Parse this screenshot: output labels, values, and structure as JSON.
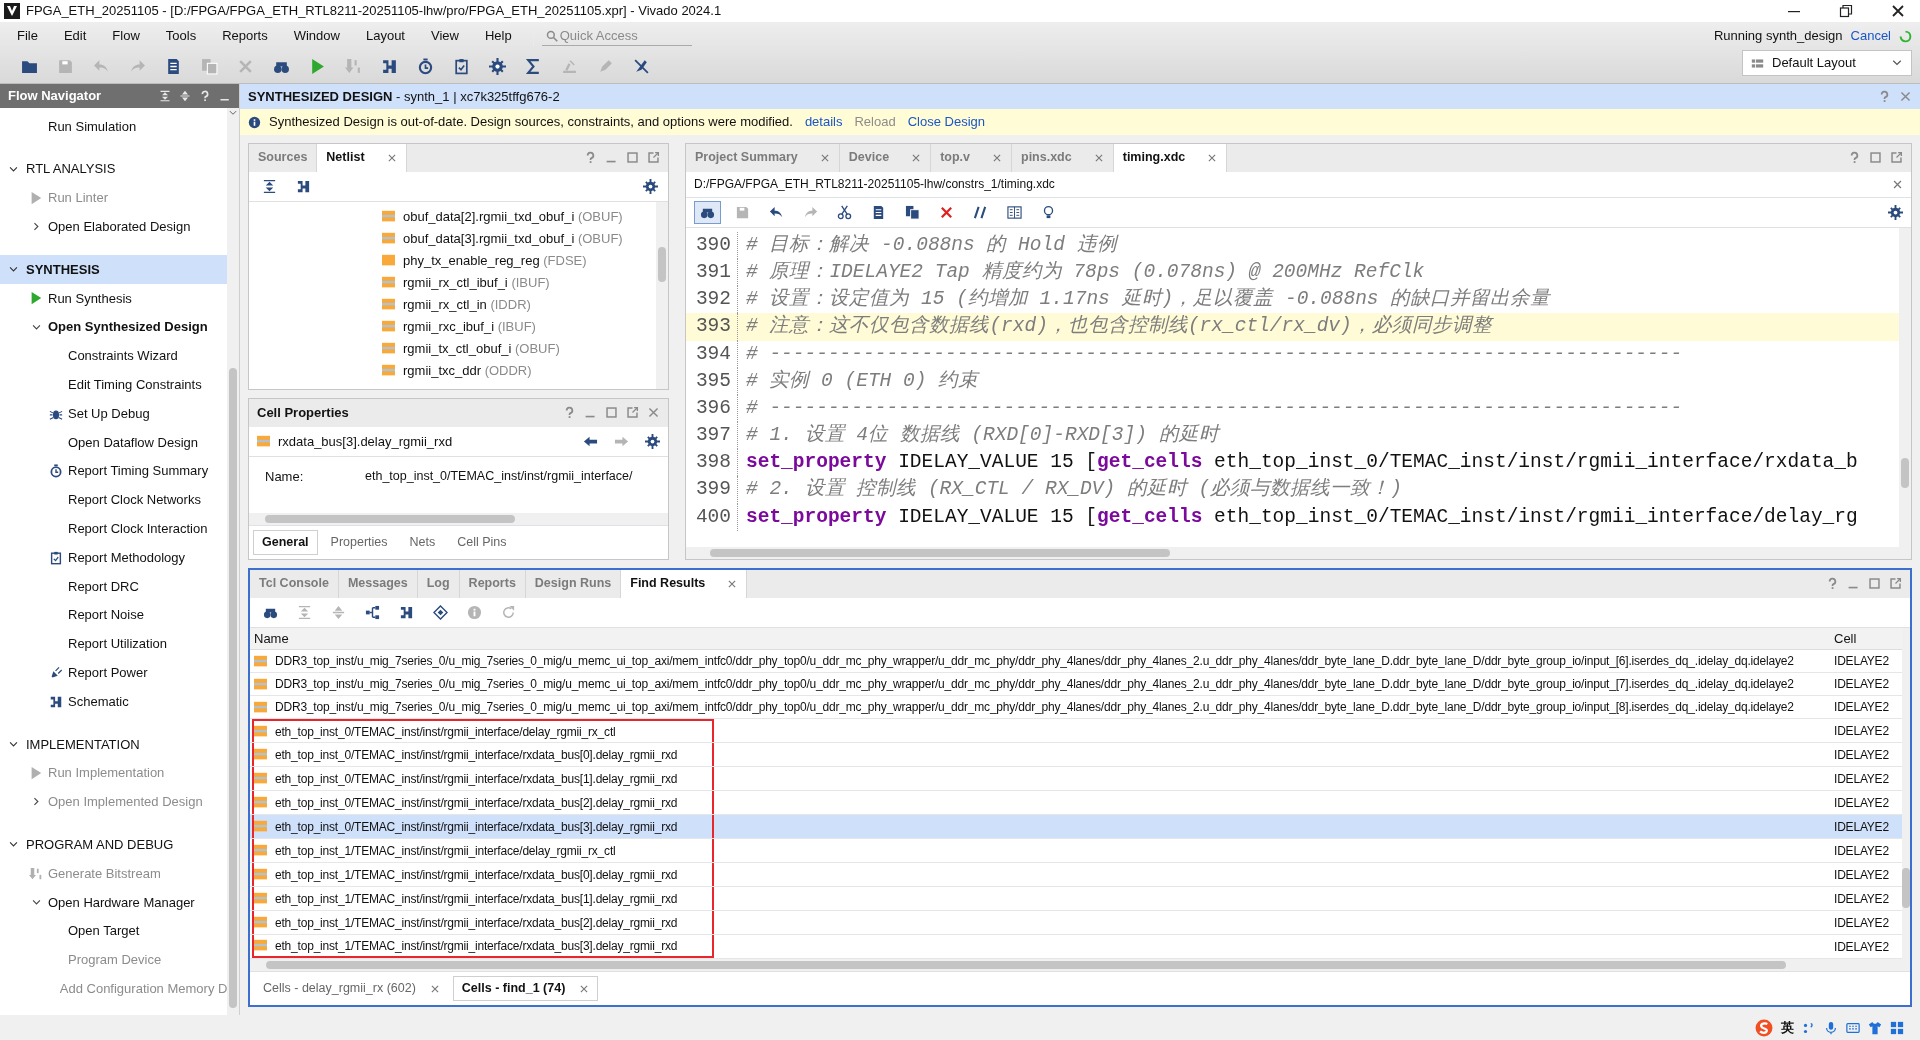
{
  "title_bar": {
    "title": "FPGA_ETH_20251105 - [D:/FPGA/FPGA_ETH_RTL8211-20251105-lhw/pro/FPGA_ETH_20251105.xpr] - Vivado 2024.1"
  },
  "menu": [
    "File",
    "Edit",
    "Flow",
    "Tools",
    "Reports",
    "Window",
    "Layout",
    "View",
    "Help"
  ],
  "quick_access": {
    "placeholder": "Quick Access"
  },
  "toolbar": [
    {
      "kind": "open",
      "disabled": false
    },
    {
      "kind": "save",
      "disabled": true
    },
    {
      "kind": "undo",
      "disabled": true
    },
    {
      "kind": "redo",
      "disabled": true
    },
    {
      "kind": "copy",
      "disabled": false
    },
    {
      "kind": "paste",
      "disabled": true
    },
    {
      "kind": "delete",
      "disabled": true
    },
    {
      "kind": "find",
      "disabled": false
    },
    {
      "kind": "run",
      "disabled": false
    },
    {
      "kind": "bitstream",
      "disabled": true
    },
    {
      "kind": "schematic",
      "disabled": false
    },
    {
      "kind": "timer",
      "disabled": false
    },
    {
      "kind": "checklist",
      "disabled": false
    },
    {
      "kind": "settings",
      "disabled": false
    },
    {
      "kind": "sum",
      "disabled": false
    },
    {
      "kind": "stamp",
      "disabled": true
    },
    {
      "kind": "pen",
      "disabled": true
    },
    {
      "kind": "nodebug",
      "disabled": false
    }
  ],
  "status": {
    "text": "Running synth_design",
    "link": "Cancel"
  },
  "layout_select": {
    "value": "Default Layout"
  },
  "flow_navigator": {
    "title": "Flow Navigator",
    "sections": [
      {
        "items": [
          {
            "label": "Run Simulation",
            "kind": "plain",
            "disabled": false,
            "active": false
          }
        ]
      },
      {
        "label": "RTL ANALYSIS",
        "expanded": true,
        "selected": false,
        "items": [
          {
            "label": "Run Linter",
            "kind": "run",
            "disabled": true,
            "active": false
          },
          {
            "label": "Open Elaborated Design",
            "kind": "group",
            "expanded": false,
            "disabled": false,
            "active": false
          }
        ]
      },
      {
        "label": "SYNTHESIS",
        "expanded": true,
        "selected": true,
        "items": [
          {
            "label": "Run Synthesis",
            "kind": "run",
            "disabled": false,
            "active": false
          },
          {
            "label": "Open Synthesized Design",
            "kind": "group",
            "expanded": true,
            "disabled": false,
            "active": true,
            "children": [
              {
                "label": "Constraints Wizard",
                "kind": "plain",
                "disabled": false,
                "active": false
              },
              {
                "label": "Edit Timing Constraints",
                "kind": "plain",
                "disabled": false,
                "active": false
              },
              {
                "label": "Set Up Debug",
                "kind": "debug",
                "disabled": false,
                "active": false
              },
              {
                "label": "Open Dataflow Design",
                "kind": "plain",
                "disabled": false,
                "active": false
              },
              {
                "label": "Report Timing Summary",
                "kind": "timer",
                "disabled": false,
                "active": false
              },
              {
                "label": "Report Clock Networks",
                "kind": "plain",
                "disabled": false,
                "active": false
              },
              {
                "label": "Report Clock Interaction",
                "kind": "plain",
                "disabled": false,
                "active": false
              },
              {
                "label": "Report Methodology",
                "kind": "checklist",
                "disabled": false,
                "active": false
              },
              {
                "label": "Report DRC",
                "kind": "plain",
                "disabled": false,
                "active": false
              },
              {
                "label": "Report Noise",
                "kind": "plain",
                "disabled": false,
                "active": false
              },
              {
                "label": "Report Utilization",
                "kind": "plain",
                "disabled": false,
                "active": false
              },
              {
                "label": "Report Power",
                "kind": "power",
                "disabled": false,
                "active": false
              },
              {
                "label": "Schematic",
                "kind": "schematic",
                "disabled": false,
                "active": false
              }
            ]
          }
        ]
      },
      {
        "label": "IMPLEMENTATION",
        "expanded": true,
        "selected": false,
        "items": [
          {
            "label": "Run Implementation",
            "kind": "run",
            "disabled": true,
            "active": false
          },
          {
            "label": "Open Implemented Design",
            "kind": "group",
            "expanded": false,
            "disabled": true,
            "active": false
          }
        ]
      },
      {
        "label": "PROGRAM AND DEBUG",
        "expanded": true,
        "selected": false,
        "items": [
          {
            "label": "Generate Bitstream",
            "kind": "bitstream",
            "disabled": true,
            "active": false
          },
          {
            "label": "Open Hardware Manager",
            "kind": "group",
            "expanded": true,
            "disabled": false,
            "active": false,
            "children": [
              {
                "label": "Open Target",
                "kind": "plain",
                "disabled": false,
                "active": false
              },
              {
                "label": "Program Device",
                "kind": "plain",
                "disabled": true,
                "active": false
              },
              {
                "label": "Add Configuration Memory D",
                "kind": "plain",
                "disabled": true,
                "active": false
              }
            ]
          }
        ]
      }
    ]
  },
  "design_header": {
    "title": "**SYNTHESIZED DESIGN** - synth_1 | xc7k325tffg676-2"
  },
  "info_bar": {
    "message": "Synthesized Design is out-of-date. Design sources, constraints, and options were modified.",
    "links": [
      {
        "label": "details",
        "disabled": false
      },
      {
        "label": "Reload",
        "disabled": true
      },
      {
        "label": "Close Design",
        "disabled": false
      }
    ]
  },
  "netlist_panel": {
    "tabs": [
      {
        "label": "Sources",
        "selected": false
      },
      {
        "label": "Netlist",
        "selected": true
      }
    ],
    "toolbar": [
      {
        "kind": "collapse",
        "disabled": false
      },
      {
        "kind": "schematic",
        "disabled": false
      }
    ],
    "rows": [
      {
        "name": "obuf_data[2].rgmii_txd_obuf_i",
        "type": "(OBUF)",
        "kind": "primitive"
      },
      {
        "name": "obuf_data[3].rgmii_txd_obuf_i",
        "type": "(OBUF)",
        "kind": "primitive"
      },
      {
        "name": "phy_tx_enable_reg_reg",
        "type": "(FDSE)",
        "kind": "register"
      },
      {
        "name": "rgmii_rx_ctl_ibuf_i",
        "type": "(IBUF)",
        "kind": "primitive"
      },
      {
        "name": "rgmii_rx_ctl_in",
        "type": "(IDDR)",
        "kind": "primitive"
      },
      {
        "name": "rgmii_rxc_ibuf_i",
        "type": "(IBUF)",
        "kind": "primitive"
      },
      {
        "name": "rgmii_tx_ctl_obuf_i",
        "type": "(OBUF)",
        "kind": "primitive"
      },
      {
        "name": "rgmii_txc_ddr",
        "type": "(ODDR)",
        "kind": "primitive"
      }
    ]
  },
  "cell_properties": {
    "title": "Cell Properties",
    "cell": "rxdata_bus[3].delay_rgmii_rxd",
    "fields": [
      {
        "label": "Name:",
        "value": "eth_top_inst_0/TEMAC_inst/inst/rgmii_interface/"
      }
    ],
    "tabs": [
      {
        "label": "General",
        "selected": true
      },
      {
        "label": "Properties",
        "selected": false
      },
      {
        "label": "Nets",
        "selected": false
      },
      {
        "label": "Cell Pins",
        "selected": false
      }
    ]
  },
  "editor": {
    "tabs": [
      {
        "label": "Project Summary",
        "selected": false
      },
      {
        "label": "Device",
        "selected": false
      },
      {
        "label": "top.v",
        "selected": false
      },
      {
        "label": "pins.xdc",
        "selected": false
      },
      {
        "label": "timing.xdc",
        "selected": true
      }
    ],
    "path": "D:/FPGA/FPGA_ETH_RTL8211-20251105-lhw/constrs_1/timing.xdc",
    "toolbar": [
      {
        "kind": "find",
        "disabled": false
      },
      {
        "kind": "save",
        "disabled": true
      },
      {
        "kind": "undo",
        "disabled": false
      },
      {
        "kind": "redo",
        "disabled": true
      },
      {
        "kind": "cut",
        "disabled": false
      },
      {
        "kind": "copy",
        "disabled": false
      },
      {
        "kind": "paste",
        "disabled": false
      },
      {
        "kind": "delete",
        "disabled": false
      },
      {
        "kind": "comment",
        "disabled": false
      },
      {
        "kind": "columns",
        "disabled": false
      },
      {
        "kind": "hint",
        "disabled": false
      }
    ],
    "lines": [
      {
        "number": "390",
        "current": false,
        "segments": [
          {
            "kind": "comment",
            "text": "# 目标：解决 -0.088ns 的 Hold 违例"
          }
        ]
      },
      {
        "number": "391",
        "current": false,
        "segments": [
          {
            "kind": "comment",
            "text": "# 原理：IDELAYE2 Tap 精度约为 78ps (0.078ns) @ 200MHz RefClk"
          }
        ]
      },
      {
        "number": "392",
        "current": false,
        "segments": [
          {
            "kind": "comment",
            "text": "# 设置：设定值为 15 (约增加 1.17ns 延时)，足以覆盖 -0.088ns 的缺口并留出余量"
          }
        ]
      },
      {
        "number": "393",
        "current": true,
        "segments": [
          {
            "kind": "comment",
            "text": "# 注意：这不仅包含数据线(rxd)，也包含控制线(rx_ctl/rx_dv)，必须同步调整"
          }
        ]
      },
      {
        "number": "394",
        "current": false,
        "segments": [
          {
            "kind": "comment",
            "text": "# ------------------------------------------------------------------------------"
          }
        ]
      },
      {
        "number": "395",
        "current": false,
        "segments": [
          {
            "kind": "comment",
            "text": "# 实例 0 (ETH 0) 约束"
          }
        ]
      },
      {
        "number": "396",
        "current": false,
        "segments": [
          {
            "kind": "comment",
            "text": "# ------------------------------------------------------------------------------"
          }
        ]
      },
      {
        "number": "397",
        "current": false,
        "segments": [
          {
            "kind": "comment",
            "text": "# 1. 设置 4位 数据线 (RXD[0]-RXD[3]) 的延时"
          }
        ]
      },
      {
        "number": "398",
        "current": false,
        "segments": [
          {
            "kind": "keyword",
            "text": "set_property"
          },
          {
            "kind": "plain",
            "text": " IDELAY_VALUE 15 ["
          },
          {
            "kind": "keyword",
            "text": "get_cells"
          },
          {
            "kind": "plain",
            "text": " eth_top_inst_0/TEMAC_inst/inst/rgmii_interface/rxdata_b"
          }
        ]
      },
      {
        "number": "399",
        "current": false,
        "segments": [
          {
            "kind": "comment",
            "text": "# 2. 设置 控制线 (RX_CTL / RX_DV) 的延时 (必须与数据线一致！)"
          }
        ]
      },
      {
        "number": "400",
        "current": false,
        "segments": [
          {
            "kind": "keyword",
            "text": "set_property"
          },
          {
            "kind": "plain",
            "text": " IDELAY_VALUE 15 ["
          },
          {
            "kind": "keyword",
            "text": "get_cells"
          },
          {
            "kind": "plain",
            "text": " eth_top_inst_0/TEMAC_inst/inst/rgmii_interface/delay_rg"
          }
        ]
      }
    ]
  },
  "find_results": {
    "tabs": [
      {
        "label": "Tcl Console",
        "selected": false
      },
      {
        "label": "Messages",
        "selected": false
      },
      {
        "label": "Log",
        "selected": false
      },
      {
        "label": "Reports",
        "selected": false
      },
      {
        "label": "Design Runs",
        "selected": false
      },
      {
        "label": "Find Results",
        "selected": true
      }
    ],
    "toolbar": [
      {
        "kind": "find",
        "disabled": false
      },
      {
        "kind": "collapse",
        "disabled": true
      },
      {
        "kind": "expand",
        "disabled": true
      },
      {
        "kind": "tree",
        "disabled": false
      },
      {
        "kind": "schematic",
        "disabled": false
      },
      {
        "kind": "diamond",
        "disabled": false
      },
      {
        "kind": "info",
        "disabled": true
      },
      {
        "kind": "refresh",
        "disabled": true
      }
    ],
    "columns": [
      "Name",
      "Cell"
    ],
    "rows": [
      {
        "name": "DDR3_top_inst/u_mig_7series_0/u_mig_7series_0_mig/u_memc_ui_top_axi/mem_intfc0/ddr_phy_top0/u_ddr_mc_phy_wrapper/u_ddr_mc_phy/ddr_phy_4lanes/ddr_phy_4lanes_2.u_ddr_phy_4lanes/ddr_byte_lane_D.ddr_byte_lane_D/ddr_byte_group_io/input_[6].iserdes_dq_.idelay_dq.idelaye2",
        "cell": "IDELAYE2",
        "selected": false,
        "outlined": false
      },
      {
        "name": "DDR3_top_inst/u_mig_7series_0/u_mig_7series_0_mig/u_memc_ui_top_axi/mem_intfc0/ddr_phy_top0/u_ddr_mc_phy_wrapper/u_ddr_mc_phy/ddr_phy_4lanes/ddr_phy_4lanes_2.u_ddr_phy_4lanes/ddr_byte_lane_D.ddr_byte_lane_D/ddr_byte_group_io/input_[7].iserdes_dq_.idelay_dq.idelaye2",
        "cell": "IDELAYE2",
        "selected": false,
        "outlined": false
      },
      {
        "name": "DDR3_top_inst/u_mig_7series_0/u_mig_7series_0_mig/u_memc_ui_top_axi/mem_intfc0/ddr_phy_top0/u_ddr_mc_phy_wrapper/u_ddr_mc_phy/ddr_phy_4lanes/ddr_phy_4lanes_2.u_ddr_phy_4lanes/ddr_byte_lane_D.ddr_byte_lane_D/ddr_byte_group_io/input_[8].iserdes_dq_.idelay_dq.idelaye2",
        "cell": "IDELAYE2",
        "selected": false,
        "outlined": false
      },
      {
        "name": "eth_top_inst_0/TEMAC_inst/inst/rgmii_interface/delay_rgmii_rx_ctl",
        "cell": "IDELAYE2",
        "selected": false,
        "outlined": true
      },
      {
        "name": "eth_top_inst_0/TEMAC_inst/inst/rgmii_interface/rxdata_bus[0].delay_rgmii_rxd",
        "cell": "IDELAYE2",
        "selected": false,
        "outlined": true
      },
      {
        "name": "eth_top_inst_0/TEMAC_inst/inst/rgmii_interface/rxdata_bus[1].delay_rgmii_rxd",
        "cell": "IDELAYE2",
        "selected": false,
        "outlined": true
      },
      {
        "name": "eth_top_inst_0/TEMAC_inst/inst/rgmii_interface/rxdata_bus[2].delay_rgmii_rxd",
        "cell": "IDELAYE2",
        "selected": false,
        "outlined": true
      },
      {
        "name": "eth_top_inst_0/TEMAC_inst/inst/rgmii_interface/rxdata_bus[3].delay_rgmii_rxd",
        "cell": "IDELAYE2",
        "selected": true,
        "outlined": true
      },
      {
        "name": "eth_top_inst_1/TEMAC_inst/inst/rgmii_interface/delay_rgmii_rx_ctl",
        "cell": "IDELAYE2",
        "selected": false,
        "outlined": true
      },
      {
        "name": "eth_top_inst_1/TEMAC_inst/inst/rgmii_interface/rxdata_bus[0].delay_rgmii_rxd",
        "cell": "IDELAYE2",
        "selected": false,
        "outlined": true
      },
      {
        "name": "eth_top_inst_1/TEMAC_inst/inst/rgmii_interface/rxdata_bus[1].delay_rgmii_rxd",
        "cell": "IDELAYE2",
        "selected": false,
        "outlined": true
      },
      {
        "name": "eth_top_inst_1/TEMAC_inst/inst/rgmii_interface/rxdata_bus[2].delay_rgmii_rxd",
        "cell": "IDELAYE2",
        "selected": false,
        "outlined": true
      },
      {
        "name": "eth_top_inst_1/TEMAC_inst/inst/rgmii_interface/rxdata_bus[3].delay_rgmii_rxd",
        "cell": "IDELAYE2",
        "selected": false,
        "outlined": true
      }
    ],
    "result_tabs": [
      {
        "label": "Cells - delay_rgmii_rx (602)",
        "selected": false
      },
      {
        "label": "Cells - find_1 (74)",
        "selected": true
      }
    ]
  },
  "input_method": {
    "mode": "英"
  }
}
